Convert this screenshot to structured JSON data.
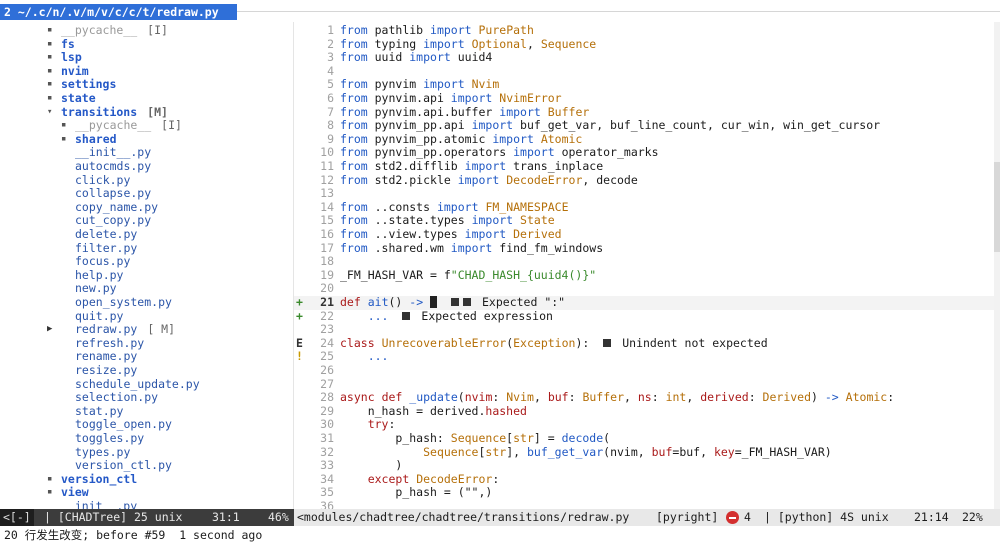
{
  "tab": {
    "number": "2",
    "title": "~/.c/n/.v/m/v/c/c/t/redraw.py"
  },
  "tree": [
    {
      "indent": 0,
      "kind": "dir-dim",
      "name": "__pycache__",
      "badge": "[I]"
    },
    {
      "indent": 0,
      "kind": "dir",
      "name": "fs"
    },
    {
      "indent": 0,
      "kind": "dir",
      "name": "lsp"
    },
    {
      "indent": 0,
      "kind": "dir",
      "name": "nvim"
    },
    {
      "indent": 0,
      "kind": "dir",
      "name": "settings"
    },
    {
      "indent": 0,
      "kind": "dir",
      "name": "state"
    },
    {
      "indent": 0,
      "kind": "dir-open",
      "name": "transitions",
      "badge": "[M]"
    },
    {
      "indent": 1,
      "kind": "dir-dim",
      "name": "__pycache__",
      "badge": "[I]"
    },
    {
      "indent": 1,
      "kind": "dir",
      "name": "shared"
    },
    {
      "indent": 1,
      "kind": "file",
      "name": "__init__.py"
    },
    {
      "indent": 1,
      "kind": "file",
      "name": "autocmds.py"
    },
    {
      "indent": 1,
      "kind": "file",
      "name": "click.py"
    },
    {
      "indent": 1,
      "kind": "file",
      "name": "collapse.py"
    },
    {
      "indent": 1,
      "kind": "file",
      "name": "copy_name.py"
    },
    {
      "indent": 1,
      "kind": "file",
      "name": "cut_copy.py"
    },
    {
      "indent": 1,
      "kind": "file",
      "name": "delete.py"
    },
    {
      "indent": 1,
      "kind": "file",
      "name": "filter.py"
    },
    {
      "indent": 1,
      "kind": "file",
      "name": "focus.py"
    },
    {
      "indent": 1,
      "kind": "file",
      "name": "help.py"
    },
    {
      "indent": 1,
      "kind": "file",
      "name": "new.py"
    },
    {
      "indent": 1,
      "kind": "file",
      "name": "open_system.py"
    },
    {
      "indent": 1,
      "kind": "file",
      "name": "quit.py"
    },
    {
      "indent": 1,
      "kind": "file-current",
      "name": "redraw.py",
      "badge": "[ M]"
    },
    {
      "indent": 1,
      "kind": "file",
      "name": "refresh.py"
    },
    {
      "indent": 1,
      "kind": "file",
      "name": "rename.py"
    },
    {
      "indent": 1,
      "kind": "file",
      "name": "resize.py"
    },
    {
      "indent": 1,
      "kind": "file",
      "name": "schedule_update.py"
    },
    {
      "indent": 1,
      "kind": "file",
      "name": "selection.py"
    },
    {
      "indent": 1,
      "kind": "file",
      "name": "stat.py"
    },
    {
      "indent": 1,
      "kind": "file",
      "name": "toggle_open.py"
    },
    {
      "indent": 1,
      "kind": "file",
      "name": "toggles.py"
    },
    {
      "indent": 1,
      "kind": "file",
      "name": "types.py"
    },
    {
      "indent": 1,
      "kind": "file",
      "name": "version_ctl.py"
    },
    {
      "indent": 0,
      "kind": "dir",
      "name": "version_ctl"
    },
    {
      "indent": 0,
      "kind": "dir",
      "name": "view"
    },
    {
      "indent": 0,
      "kind": "file",
      "name": "__init__.py"
    }
  ],
  "code": [
    {
      "n": "1",
      "sign": "",
      "tokens": [
        [
          "kw",
          "from"
        ],
        [
          "pl",
          " pathlib "
        ],
        [
          "kw",
          "import"
        ],
        [
          "pl",
          " "
        ],
        [
          "ty",
          "PurePath"
        ]
      ]
    },
    {
      "n": "2",
      "sign": "",
      "tokens": [
        [
          "kw",
          "from"
        ],
        [
          "pl",
          " typing "
        ],
        [
          "kw",
          "import"
        ],
        [
          "pl",
          " "
        ],
        [
          "ty",
          "Optional"
        ],
        [
          "pl",
          ", "
        ],
        [
          "ty",
          "Sequence"
        ]
      ]
    },
    {
      "n": "3",
      "sign": "",
      "tokens": [
        [
          "kw",
          "from"
        ],
        [
          "pl",
          " uuid "
        ],
        [
          "kw",
          "import"
        ],
        [
          "pl",
          " uuid4"
        ]
      ]
    },
    {
      "n": "4",
      "sign": "",
      "tokens": []
    },
    {
      "n": "5",
      "sign": "",
      "tokens": [
        [
          "kw",
          "from"
        ],
        [
          "pl",
          " pynvim "
        ],
        [
          "kw",
          "import"
        ],
        [
          "pl",
          " "
        ],
        [
          "ty",
          "Nvim"
        ]
      ]
    },
    {
      "n": "6",
      "sign": "",
      "tokens": [
        [
          "kw",
          "from"
        ],
        [
          "pl",
          " pynvim.api "
        ],
        [
          "kw",
          "import"
        ],
        [
          "pl",
          " "
        ],
        [
          "ty",
          "NvimError"
        ]
      ]
    },
    {
      "n": "7",
      "sign": "",
      "tokens": [
        [
          "kw",
          "from"
        ],
        [
          "pl",
          " pynvim.api.buffer "
        ],
        [
          "kw",
          "import"
        ],
        [
          "pl",
          " "
        ],
        [
          "ty",
          "Buffer"
        ]
      ]
    },
    {
      "n": "8",
      "sign": "",
      "tokens": [
        [
          "kw",
          "from"
        ],
        [
          "pl",
          " pynvim_pp.api "
        ],
        [
          "kw",
          "import"
        ],
        [
          "pl",
          " buf_get_var, buf_line_count, cur_win, win_get_cursor"
        ]
      ]
    },
    {
      "n": "9",
      "sign": "",
      "tokens": [
        [
          "kw",
          "from"
        ],
        [
          "pl",
          " pynvim_pp.atomic "
        ],
        [
          "kw",
          "import"
        ],
        [
          "pl",
          " "
        ],
        [
          "ty",
          "Atomic"
        ]
      ]
    },
    {
      "n": "10",
      "sign": "",
      "tokens": [
        [
          "kw",
          "from"
        ],
        [
          "pl",
          " pynvim_pp.operators "
        ],
        [
          "kw",
          "import"
        ],
        [
          "pl",
          " operator_marks"
        ]
      ]
    },
    {
      "n": "11",
      "sign": "",
      "tokens": [
        [
          "kw",
          "from"
        ],
        [
          "pl",
          " std2.difflib "
        ],
        [
          "kw",
          "import"
        ],
        [
          "pl",
          " trans_inplace"
        ]
      ]
    },
    {
      "n": "12",
      "sign": "",
      "tokens": [
        [
          "kw",
          "from"
        ],
        [
          "pl",
          " std2.pickle "
        ],
        [
          "kw",
          "import"
        ],
        [
          "pl",
          " "
        ],
        [
          "ty",
          "DecodeError"
        ],
        [
          "pl",
          ", decode"
        ]
      ]
    },
    {
      "n": "13",
      "sign": "",
      "tokens": []
    },
    {
      "n": "14",
      "sign": "",
      "tokens": [
        [
          "kw",
          "from"
        ],
        [
          "pl",
          " ..consts "
        ],
        [
          "kw",
          "import"
        ],
        [
          "pl",
          " "
        ],
        [
          "ty",
          "FM_NAMESPACE"
        ]
      ]
    },
    {
      "n": "15",
      "sign": "",
      "tokens": [
        [
          "kw",
          "from"
        ],
        [
          "pl",
          " ..state.types "
        ],
        [
          "kw",
          "import"
        ],
        [
          "pl",
          " "
        ],
        [
          "ty",
          "State"
        ]
      ]
    },
    {
      "n": "16",
      "sign": "",
      "tokens": [
        [
          "kw",
          "from"
        ],
        [
          "pl",
          " ..view.types "
        ],
        [
          "kw",
          "import"
        ],
        [
          "pl",
          " "
        ],
        [
          "ty",
          "Derived"
        ]
      ]
    },
    {
      "n": "17",
      "sign": "",
      "tokens": [
        [
          "kw",
          "from"
        ],
        [
          "pl",
          " .shared.wm "
        ],
        [
          "kw",
          "import"
        ],
        [
          "pl",
          " find_fm_windows"
        ]
      ]
    },
    {
      "n": "18",
      "sign": "",
      "tokens": []
    },
    {
      "n": "19",
      "sign": "",
      "tokens": [
        [
          "pl",
          "_FM_HASH_VAR = f"
        ],
        [
          "st",
          "\"CHAD_HASH_{uuid4()}\""
        ]
      ]
    },
    {
      "n": "20",
      "sign": "",
      "tokens": []
    },
    {
      "n": "21",
      "sign": "+",
      "current": true,
      "tokens": [
        [
          "dp",
          "def"
        ],
        [
          "pl",
          " "
        ],
        [
          "kw",
          "ait"
        ],
        [
          "pl",
          "() "
        ],
        [
          "kw",
          "->"
        ],
        [
          "pl",
          " "
        ],
        [
          "cursor",
          ""
        ],
        [
          "diag2",
          "Expected \":\""
        ]
      ]
    },
    {
      "n": "22",
      "sign": "+",
      "tokens": [
        [
          "pl",
          "    "
        ],
        [
          "kw",
          "..."
        ],
        [
          "diag",
          "Expected expression"
        ]
      ]
    },
    {
      "n": "23",
      "sign": "",
      "tokens": []
    },
    {
      "n": "24",
      "sign": "E",
      "tokens": [
        [
          "dp",
          "class"
        ],
        [
          "pl",
          " "
        ],
        [
          "ty",
          "UnrecoverableError"
        ],
        [
          "pl",
          "("
        ],
        [
          "ty",
          "Exception"
        ],
        [
          "pl",
          "):"
        ],
        [
          "diag",
          "Unindent not expected"
        ]
      ]
    },
    {
      "n": "25",
      "sign": "!",
      "tokens": [
        [
          "pl",
          "    "
        ],
        [
          "kw",
          "..."
        ]
      ]
    },
    {
      "n": "26",
      "sign": "",
      "tokens": []
    },
    {
      "n": "27",
      "sign": "",
      "tokens": []
    },
    {
      "n": "28",
      "sign": "",
      "tokens": [
        [
          "dp",
          "async"
        ],
        [
          "pl",
          " "
        ],
        [
          "dp",
          "def"
        ],
        [
          "pl",
          " "
        ],
        [
          "kw",
          "_update"
        ],
        [
          "pl",
          "("
        ],
        [
          "dp",
          "nvim"
        ],
        [
          "pl",
          ": "
        ],
        [
          "ty",
          "Nvim"
        ],
        [
          "pl",
          ", "
        ],
        [
          "dp",
          "buf"
        ],
        [
          "pl",
          ": "
        ],
        [
          "ty",
          "Buffer"
        ],
        [
          "pl",
          ", "
        ],
        [
          "dp",
          "ns"
        ],
        [
          "pl",
          ": "
        ],
        [
          "ty",
          "int"
        ],
        [
          "pl",
          ", "
        ],
        [
          "dp",
          "derived"
        ],
        [
          "pl",
          ": "
        ],
        [
          "ty",
          "Derived"
        ],
        [
          "pl",
          ") "
        ],
        [
          "kw",
          "->"
        ],
        [
          "pl",
          " "
        ],
        [
          "ty",
          "Atomic"
        ],
        [
          "pl",
          ":"
        ]
      ]
    },
    {
      "n": "29",
      "sign": "",
      "tokens": [
        [
          "pl",
          "    n_hash = derived."
        ],
        [
          "dp",
          "hashed"
        ]
      ]
    },
    {
      "n": "30",
      "sign": "",
      "tokens": [
        [
          "pl",
          "    "
        ],
        [
          "dp",
          "try"
        ],
        [
          "pl",
          ":"
        ]
      ]
    },
    {
      "n": "31",
      "sign": "",
      "tokens": [
        [
          "pl",
          "        p_hash: "
        ],
        [
          "ty",
          "Sequence"
        ],
        [
          "pl",
          "["
        ],
        [
          "ty",
          "str"
        ],
        [
          "pl",
          "] = "
        ],
        [
          "kw",
          "decode"
        ],
        [
          "pl",
          "("
        ]
      ]
    },
    {
      "n": "32",
      "sign": "",
      "tokens": [
        [
          "pl",
          "            "
        ],
        [
          "ty",
          "Sequence"
        ],
        [
          "pl",
          "["
        ],
        [
          "ty",
          "str"
        ],
        [
          "pl",
          "], "
        ],
        [
          "kw",
          "buf_get_var"
        ],
        [
          "pl",
          "(nvim, "
        ],
        [
          "dp",
          "buf"
        ],
        [
          "pl",
          "=buf, "
        ],
        [
          "dp",
          "key"
        ],
        [
          "pl",
          "=_FM_HASH_VAR)"
        ]
      ]
    },
    {
      "n": "33",
      "sign": "",
      "tokens": [
        [
          "pl",
          "        )"
        ]
      ]
    },
    {
      "n": "34",
      "sign": "",
      "tokens": [
        [
          "pl",
          "    "
        ],
        [
          "dp",
          "except"
        ],
        [
          "pl",
          " "
        ],
        [
          "ty",
          "DecodeError"
        ],
        [
          "pl",
          ":"
        ]
      ]
    },
    {
      "n": "35",
      "sign": "",
      "tokens": [
        [
          "pl",
          "        p_hash = (\"\",)"
        ]
      ]
    },
    {
      "n": "36",
      "sign": "",
      "tokens": []
    }
  ],
  "statusline": {
    "mode": "<[-]",
    "left_text": "| [CHADTree] 25 unix",
    "left_pos": "31:1",
    "left_pct": "46%",
    "path": "<modules/chadtree/chadtree/transitions/redraw.py",
    "lsp": "[pyright]",
    "error_count": "4",
    "lang": "| [python] 4S unix",
    "cursor": "21:14",
    "pct": "22%"
  },
  "cmdline": "20 行发生改变; before #59  1 second ago",
  "colors": {
    "tab_bg": "#2f6fd8",
    "error": "#d32f2f"
  }
}
